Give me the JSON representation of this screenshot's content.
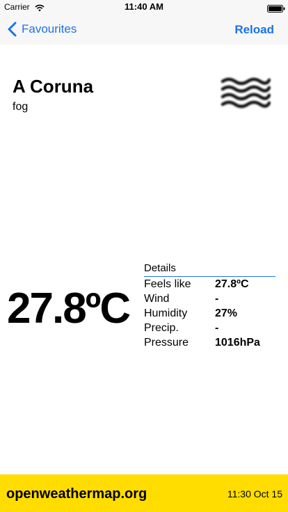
{
  "status_bar": {
    "carrier": "Carrier",
    "time": "11:40 AM",
    "wifi_icon": "wifi-icon",
    "battery_icon": "battery-icon"
  },
  "nav": {
    "back_label": "Favourites",
    "back_icon": "chevron-left-icon",
    "reload_label": "Reload",
    "accent_color": "#1a73e8"
  },
  "weather": {
    "city": "A Coruna",
    "condition": "fog",
    "icon": "fog-icon",
    "temperature": "27.8ºC"
  },
  "details": {
    "title": "Details",
    "rows": [
      {
        "label": "Feels like",
        "value": "27.8ºC"
      },
      {
        "label": "Wind",
        "value": "-"
      },
      {
        "label": "Humidity",
        "value": "27%"
      },
      {
        "label": "Precip.",
        "value": "-"
      },
      {
        "label": "Pressure",
        "value": "1016hPa"
      }
    ]
  },
  "footer": {
    "brand": "openweathermap.org",
    "timestamp": "11:30 Oct 15",
    "background_color": "#ffdd00"
  }
}
